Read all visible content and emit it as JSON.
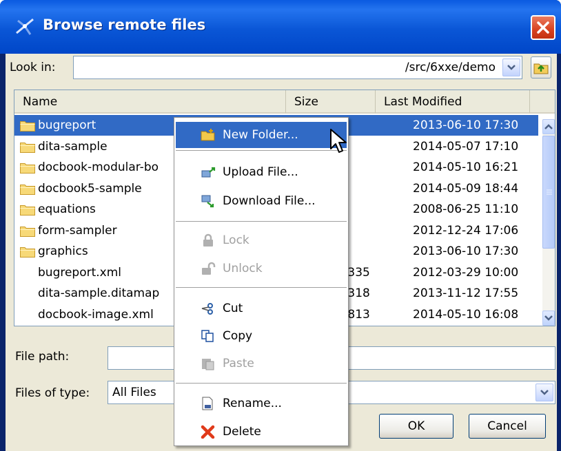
{
  "window": {
    "title": "Browse remote files"
  },
  "look_in": {
    "label": "Look in:",
    "value": "/src/6xxe/demo"
  },
  "table": {
    "columns": [
      "Name",
      "Size",
      "Last Modified"
    ],
    "rows": [
      {
        "name": "bugreport",
        "size": "",
        "modified": "2013-06-10 17:30",
        "type": "folder",
        "selected": true
      },
      {
        "name": "dita-sample",
        "size": "",
        "modified": "2014-05-07 17:10",
        "type": "folder"
      },
      {
        "name": "docbook-modular-bo",
        "size": "",
        "modified": "2014-05-10 16:21",
        "type": "folder"
      },
      {
        "name": "docbook5-sample",
        "size": "",
        "modified": "2014-05-09 18:44",
        "type": "folder"
      },
      {
        "name": "equations",
        "size": "",
        "modified": "2008-06-25 11:10",
        "type": "folder"
      },
      {
        "name": "form-sampler",
        "size": "",
        "modified": "2012-12-24 17:06",
        "type": "folder"
      },
      {
        "name": "graphics",
        "size": "",
        "modified": "2013-06-10 17:30",
        "type": "folder"
      },
      {
        "name": "bugreport.xml",
        "size": ".335",
        "modified": "2012-03-29 10:00",
        "type": "file"
      },
      {
        "name": "dita-sample.ditamap",
        "size": ".318",
        "modified": "2013-11-12 17:55",
        "type": "file"
      },
      {
        "name": "docbook-image.xml",
        "size": ".813",
        "modified": "2014-05-10 16:08",
        "type": "file"
      }
    ]
  },
  "file_path": {
    "label": "File path:",
    "value": ""
  },
  "files_of_type": {
    "label": "Files of type:",
    "value": "All Files"
  },
  "buttons": {
    "ok": "OK",
    "cancel": "Cancel"
  },
  "context_menu": {
    "items": [
      {
        "label": "New Folder...",
        "icon": "new-folder-icon",
        "enabled": true,
        "highlighted": true
      },
      {
        "label": "Upload File...",
        "icon": "upload-icon",
        "enabled": true
      },
      {
        "label": "Download File...",
        "icon": "download-icon",
        "enabled": true
      },
      {
        "label": "Lock",
        "icon": "lock-icon",
        "enabled": false
      },
      {
        "label": "Unlock",
        "icon": "unlock-icon",
        "enabled": false
      },
      {
        "label": "Cut",
        "icon": "scissors-icon",
        "enabled": true
      },
      {
        "label": "Copy",
        "icon": "copy-icon",
        "enabled": true
      },
      {
        "label": "Paste",
        "icon": "paste-icon",
        "enabled": false
      },
      {
        "label": "Rename...",
        "icon": "rename-icon",
        "enabled": true
      },
      {
        "label": "Delete",
        "icon": "delete-icon",
        "enabled": true
      }
    ]
  },
  "colors": {
    "titlebar": "#0a56d6",
    "selection": "#316ac5",
    "dialog_bg": "#ece9d8"
  }
}
